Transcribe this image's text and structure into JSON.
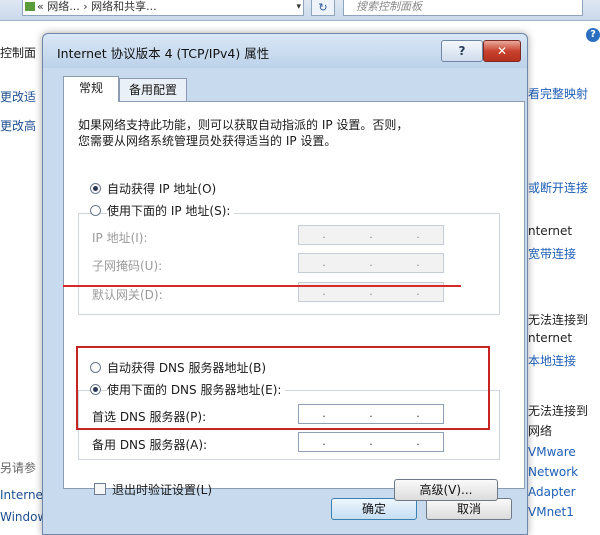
{
  "explorer": {
    "address_text": "« 网络... › 网络和共享...",
    "address_dropdown": "▾",
    "nav_refresh": "↻",
    "search_placeholder": "搜索控制面板",
    "help_glyph": "?",
    "left_items": [
      "控制面",
      "更改适",
      "更改高",
      "另请参",
      "Internet",
      "Windows"
    ],
    "right_items": [
      "看完整映射",
      "或断开连接",
      "nternet",
      "宽带连接",
      "无法连接到",
      "nternet",
      "本地连接",
      "无法连接到",
      "网络",
      "VMware",
      "Network",
      "Adapter",
      "VMnet1"
    ]
  },
  "dialog": {
    "title": "Internet 协议版本 4 (TCP/IPv4) 属性",
    "help_button": "?",
    "close_button": "✕",
    "tabs": [
      {
        "label": "常规",
        "selected": true
      },
      {
        "label": "备用配置",
        "selected": false
      }
    ],
    "description_line1": "如果网络支持此功能，则可以获取自动指派的 IP 设置。否则，",
    "description_line2": "您需要从网络系统管理员处获得适当的 IP 设置。",
    "ip_section": {
      "auto_ip_label": "自动获得 IP 地址(O)",
      "auto_ip_selected": true,
      "manual_ip_label": "使用下面的 IP 地址(S):",
      "manual_ip_selected": false,
      "fields": [
        {
          "label": "IP 地址(I):",
          "value": ". . ."
        },
        {
          "label": "子网掩码(U):",
          "value": ". . ."
        },
        {
          "label": "默认网关(D):",
          "value": ". . ."
        }
      ]
    },
    "dns_section": {
      "auto_dns_label": "自动获得 DNS 服务器地址(B)",
      "auto_dns_selected": false,
      "manual_dns_label": "使用下面的 DNS 服务器地址(E):",
      "manual_dns_selected": true,
      "fields": [
        {
          "label": "首选 DNS 服务器(P):",
          "value": ". . ."
        },
        {
          "label": "备用 DNS 服务器(A):",
          "value": ". . ."
        }
      ]
    },
    "validate_label": "退出时验证设置(L)",
    "validate_checked": false,
    "advanced_button": "高级(V)...",
    "ok_button": "确定",
    "cancel_button": "取消"
  },
  "annotations": {
    "highlight_color": "#c62323"
  }
}
